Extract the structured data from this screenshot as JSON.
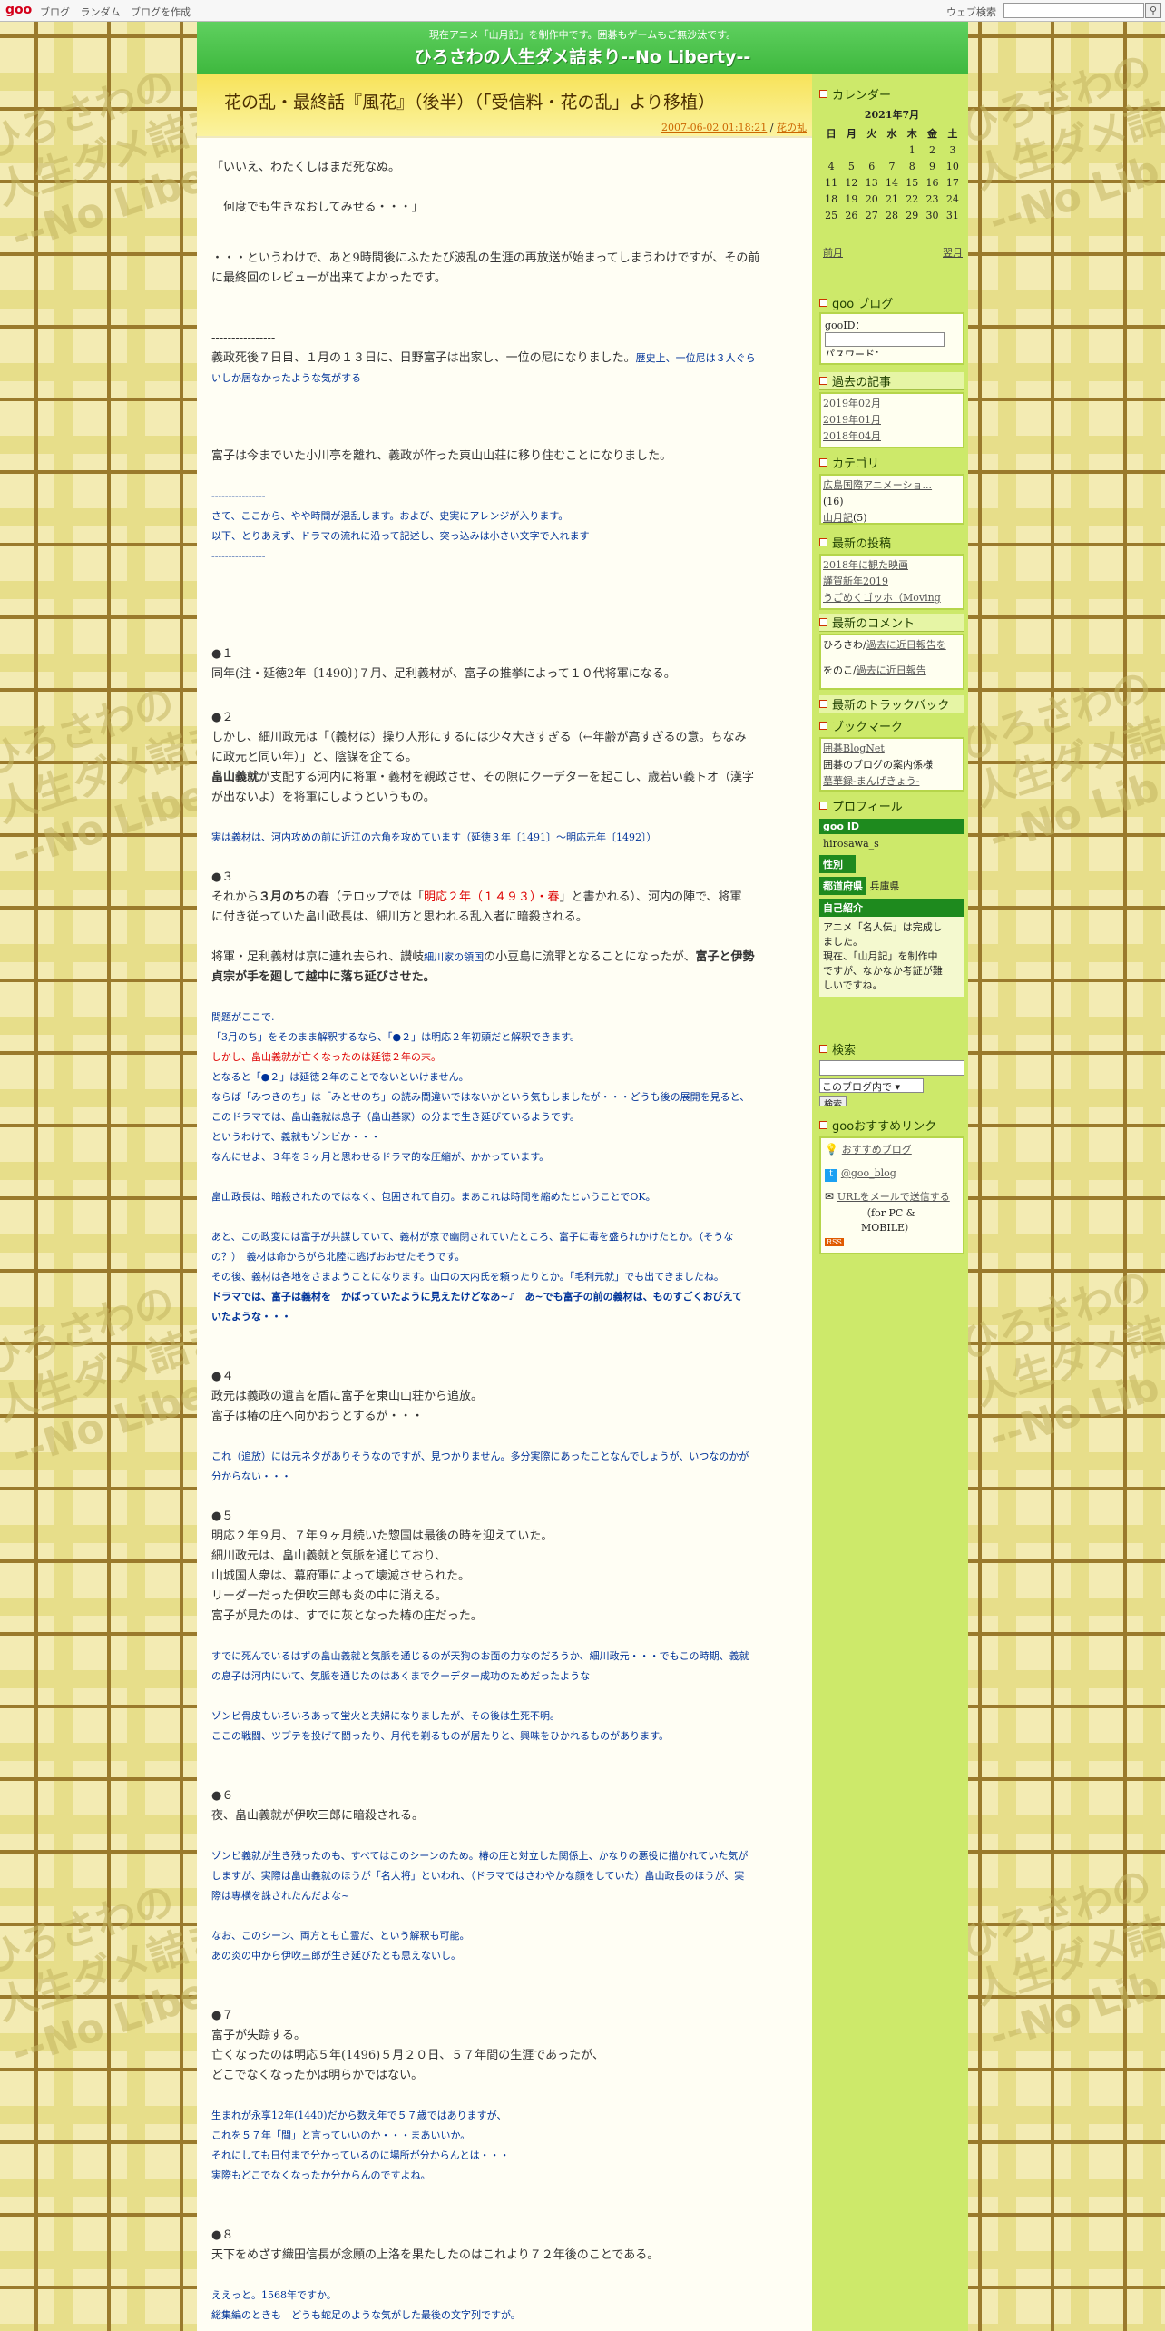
{
  "gbar": {
    "logo": "goo",
    "nav": [
      "ブログ",
      "ランダム",
      "ブログを作成"
    ],
    "search_label": "ウェブ検索",
    "search_value": ""
  },
  "header": {
    "subtitle": "現在アニメ「山月記」を制作中です。囲碁もゲームもご無沙汰です。",
    "title": "ひろさわの人生ダメ詰まり--No Liberty--"
  },
  "entry": {
    "title": "花の乱・最終話『風花』（後半）（「受信料・花の乱」より移植）",
    "date": "2007-06-02 01:18:21",
    "separator": " / ",
    "category": "花の乱"
  },
  "body": {
    "l01": "「いいえ、わたくしはまだ死なぬ。",
    "l02": "　何度でも生きなおしてみせる・・・」",
    "l03": "・・・というわけで、あと9時間後にふたたび波乱の生涯の再放送が始まってしまうわけですが、その前",
    "l04": "に最終回のレビューが出来てよかったです。",
    "l05": "----------------",
    "l06a": "義政死後７日目、１月の１３日に、日野富子は出家し、一位の尼になりました。",
    "l06b": "歴史上、一位尼は３人ぐら",
    "l07": "いしか居なかったような気がする",
    "l08": "富子は今までいた小川亭を離れ、義政が作った東山山荘に移り住むことになりました。",
    "l09": "----------------",
    "l10": "さて、ここから、やや時間が混乱します。および、史実にアレンジが入ります。",
    "l11": "以下、とりあえず、ドラマの流れに沿って記述し、突っ込みは小さい文字で入れます",
    "l12": "----------------",
    "s1h": "●１",
    "s1a": "同年(注・延徳2年〔1490〕)７月、足利義材が、富子の推挙によって１０代将軍になる。",
    "s2h": "●２",
    "s2a": "しかし、細川政元は「（義材は）操り人形にするには少々大きすぎる（←年齢が高すぎるの意。ちなみ",
    "s2b": "に政元と同い年）」と、陰謀を企てる。",
    "s2c1": "畠山義就",
    "s2c2": "が支配する河内に将軍・義材を親政させ、その隙にクーデターを起こし、歳若い義トオ（漢字",
    "s2d": "が出ないよ）を将軍にしようというもの。",
    "s2e": "実は義材は、河内攻めの前に近江の六角を攻めています（延徳３年〔1491〕～明応元年〔1492〕）",
    "s3h": "●３",
    "s3a1": "それから",
    "s3a2": "３月のち",
    "s3a3": "の春（テロップでは「",
    "s3a4": "明応２年（１４９３）・春",
    "s3a5": "」と書かれる）、河内の陣で、将軍",
    "s3b": "に付き従っていた畠山政長は、細川方と思われる乱入者に暗殺される。",
    "s3c1": "将軍・足利義材は京に連れ去られ、讃岐",
    "s3c2": "細川家の領国",
    "s3c3": "の小豆島に流罪となることになったが、",
    "s3c4": "富子と伊勢",
    "s3d": "貞宗が手を廻して越中に落ち延びさせた。",
    "s3e": "問題がここで.",
    "s3f": "「3月のち」をそのまま解釈するなら、「●２」は明応２年初頭だと解釈できます。",
    "s3g": "しかし、畠山義就が亡くなったのは延徳２年の末。",
    "s3h2": "となると「●２」は延徳２年のことでないといけません。",
    "s3i": "ならば「みつきのち」は「みとせのち」の読み間違いではないかという気もしましたが・・・どうも後の展開を見ると、",
    "s3j": "このドラマでは、畠山義就は息子（畠山基家）の分まで生き延びているようです。",
    "s3k": "というわけで、義就もゾンビか・・・",
    "s3l": "なんにせよ、３年を３ヶ月と思わせるドラマ的な圧縮が、かかっています。",
    "s3m": "畠山政長は、暗殺されたのではなく、包囲されて自刃。まあこれは時間を縮めたということでOK。",
    "s3n": "あと、この政変には富子が共謀していて、義材が京で幽閉されていたところ、富子に毒を盛られかけたとか。（そうな",
    "s3o": "の？）　義材は命からがら北陸に逃げおおせたそうです。",
    "s3p": "その後、義材は各地をさまようことになります。山口の大内氏を頼ったりとか。「毛利元就」でも出てきましたね。",
    "s3q": "ドラマでは、富子は義材を　かばっていたように見えたけどなあ~♪　あ~でも富子の前の義材は、ものすごくおびえて",
    "s3r": "いたような・・・",
    "s4h": "●４",
    "s4a": "政元は義政の遺言を盾に富子を東山山荘から追放。",
    "s4b": "富子は椿の庄へ向かおうとするが・・・",
    "s4c": "これ（追放）には元ネタがありそうなのですが、見つかりません。多分実際にあったことなんでしょうが、いつなのかが",
    "s4d": "分からない・・・",
    "s5h": "●５",
    "s5a": "明応２年９月、７年９ヶ月続いた惣国は最後の時を迎えていた。",
    "s5b": "細川政元は、畠山義就と気脈を通じており、",
    "s5c": "山城国人衆は、幕府軍によって壊滅させられた。",
    "s5d": "リーダーだった伊吹三郎も炎の中に消える。",
    "s5e": "富子が見たのは、すでに灰となった椿の庄だった。",
    "s5f": "すでに死んでいるはずの畠山義就と気脈を通じるのが天狗のお面の力なのだろうか、細川政元・・・でもこの時期、義就",
    "s5g": "の息子は河内にいて、気脈を通じたのはあくまでクーデター成功のためだったような",
    "s5h2": "ゾンビ骨皮もいろいろあって蛍火と夫婦になりましたが、その後は生死不明。",
    "s5i": "ここの戦闘、ツブテを投げて闘ったり、月代を剃るものが居たりと、興味をひかれるものがあります。",
    "s6h": "●６",
    "s6a": "夜、畠山義就が伊吹三郎に暗殺される。",
    "s6b": "ゾンビ義就が生き残ったのも、すべてはこのシーンのため。椿の庄と対立した関係上、かなりの悪役に描かれていた気が",
    "s6c": "しますが、実際は畠山義就のほうが「名大将」といわれ、（ドラマではさわやかな顔をしていた）畠山政長のほうが、実",
    "s6d": "際は専横を誅されたんだよな~",
    "s6e": "なお、このシーン、両方とも亡霊だ、という解釈も可能。",
    "s6f": "あの炎の中から伊吹三郎が生き延びたとも思えないし。",
    "s7h": "●７",
    "s7a": "富子が失踪する。",
    "s7b": "亡くなったのは明応５年(1496)５月２０日、５７年間の生涯であったが、",
    "s7c": "どこでなくなったかは明らかではない。",
    "s7d": "生まれが永享12年(1440)だから数え年で５７歳ではありますが、",
    "s7e": "これを５７年「間」と言っていいのか・・・まあいいか。",
    "s7f": "それにしても日付まで分かっているのに場所が分からんとは・・・",
    "s7g": "実際もどこでなくなったか分からんのですよね。",
    "s8h": "●８",
    "s8a": "天下をめざす織田信長が念願の上洛を果たしたのはこれより７２年後のことである。",
    "s8b": "ええっと。1568年ですか。",
    "s8c": "総集編のときも　どうも蛇足のような気がした最後の文字列ですが。"
  },
  "sidebar": {
    "calendar_h": "カレンダー",
    "calendar": {
      "month": "2021年7月",
      "days": [
        "日",
        "月",
        "火",
        "水",
        "木",
        "金",
        "土"
      ],
      "weeks": [
        [
          "",
          "",
          "",
          "",
          "1",
          "2",
          "3"
        ],
        [
          "4",
          "5",
          "6",
          "7",
          "8",
          "9",
          "10"
        ],
        [
          "11",
          "12",
          "13",
          "14",
          "15",
          "16",
          "17"
        ],
        [
          "18",
          "19",
          "20",
          "21",
          "22",
          "23",
          "24"
        ],
        [
          "25",
          "26",
          "27",
          "28",
          "29",
          "30",
          "31"
        ]
      ],
      "prev": "前月",
      "next": "翌月"
    },
    "goo_h": "goo ブログ",
    "goo_id_label": "gooID：",
    "goo_pw_label": "パスワード：",
    "archive_h": "過去の記事",
    "archive": [
      "2019年02月",
      "2019年01月",
      "2018年04月"
    ],
    "category_h": "カテゴリ",
    "categories": [
      {
        "name": "広島国際アニメーショ...",
        "count": "(16)"
      },
      {
        "name": "山月記",
        "count": "(5)"
      }
    ],
    "recent_h": "最新の投稿",
    "recent": [
      "2018年に観た映画",
      "謹賀新年2019",
      "うごめくゴッホ（Moving"
    ],
    "comments_h": "最新のコメント",
    "comments": [
      {
        "who": "ひろさわ/",
        "link": "過去に近日報告を"
      },
      {
        "who": "をのこ/",
        "link": "過去に近日報告"
      }
    ],
    "trackback_h": "最新のトラックバック",
    "bookmark_h": "ブックマーク",
    "bookmarks": [
      "囲碁BlogNet",
      "囲碁のブログの案内係様",
      "墓華録-まんげきょう-"
    ],
    "profile_h": "プロフィール",
    "profile": {
      "id_h": "goo ID",
      "id": "hirosawa_s",
      "sex_h": "性別",
      "pref_h": "都道府県",
      "pref": "兵庫県",
      "intro_h": "自己紹介",
      "intro": [
        "アニメ「名人伝」は完成し",
        "ました。",
        "現在、「山月記」を制作中",
        "ですが、なかなか考証が難",
        "しいですね。"
      ]
    },
    "search_h": "検索",
    "search_scope": "このブログ内で",
    "search_btn": "検索",
    "reco_h": "gooおすすめリンク",
    "reco": [
      "おすすめブログ",
      "@goo_blog",
      "URLをメールで送信する"
    ],
    "reco_note": "（for PC & MOBILE）",
    "rss": "RSS"
  }
}
